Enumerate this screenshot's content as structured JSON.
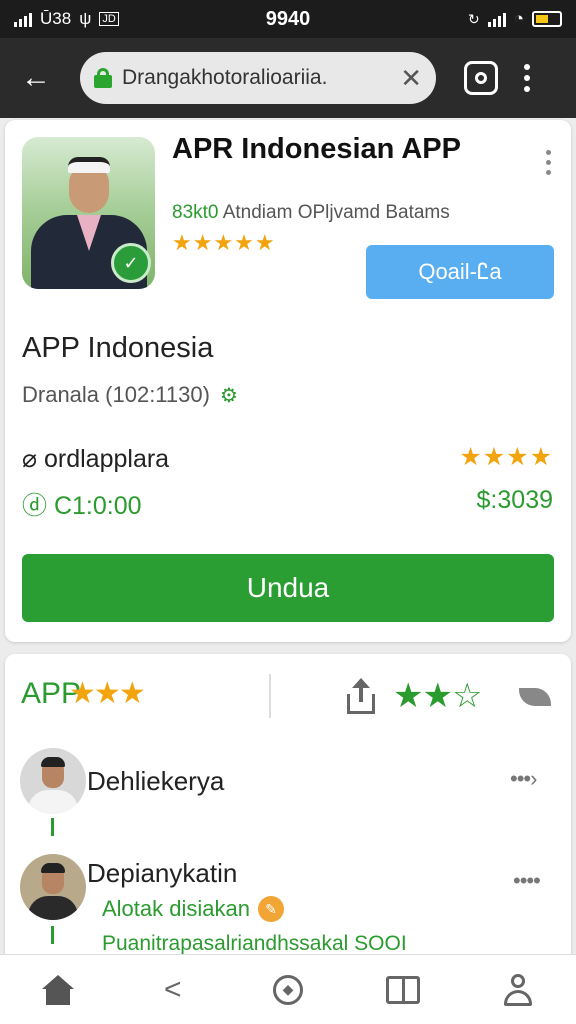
{
  "status_bar": {
    "left_text": "Ū38",
    "left_icon_box": "JD",
    "time": "9940"
  },
  "browser": {
    "url": "Drangakhotoralioariia.",
    "close_glyph": "✕",
    "back_glyph": "←"
  },
  "app": {
    "title": "APR Indonesian APP",
    "developer_highlight": "83kt0",
    "developer_text": "Atndiam OPljvamd Batams",
    "rating_stars": "★★★★★",
    "quality_button": "Qoail-Ꮭa",
    "name": "APP Indonesia",
    "meta": "Dranala (102:1130)",
    "row_label": "⌀ ordlapplara",
    "row_stars": "★★★★",
    "price_left": "ⓓ C1:0:00",
    "price_right": "$:3039",
    "download_label": "Undua"
  },
  "reviews": {
    "header_title": "APP",
    "header_stars": "★★★",
    "green_stars": "★★☆",
    "items": [
      {
        "name": "Dehliekerya",
        "more": "•••›"
      },
      {
        "name": "Depianykatin",
        "more": "••••",
        "sub1": "Alotak disiakan",
        "sub2": "Puanitrapasalriandhssakal SOOI"
      }
    ]
  },
  "bottom_nav": {
    "items": [
      "home",
      "share",
      "explore",
      "library",
      "profile"
    ]
  },
  "colors": {
    "accent_green": "#2a9d33",
    "star_orange": "#f2a40f",
    "button_blue": "#58aef0",
    "toolbar_dark": "#2b2b2b"
  },
  "icons": [
    "back-arrow-icon",
    "lock-icon",
    "close-icon",
    "camera-icon",
    "more-vert-icon",
    "verified-badge-icon",
    "gear-icon",
    "share-icon",
    "eye-icon",
    "home-icon",
    "compass-icon",
    "book-icon",
    "user-icon"
  ]
}
